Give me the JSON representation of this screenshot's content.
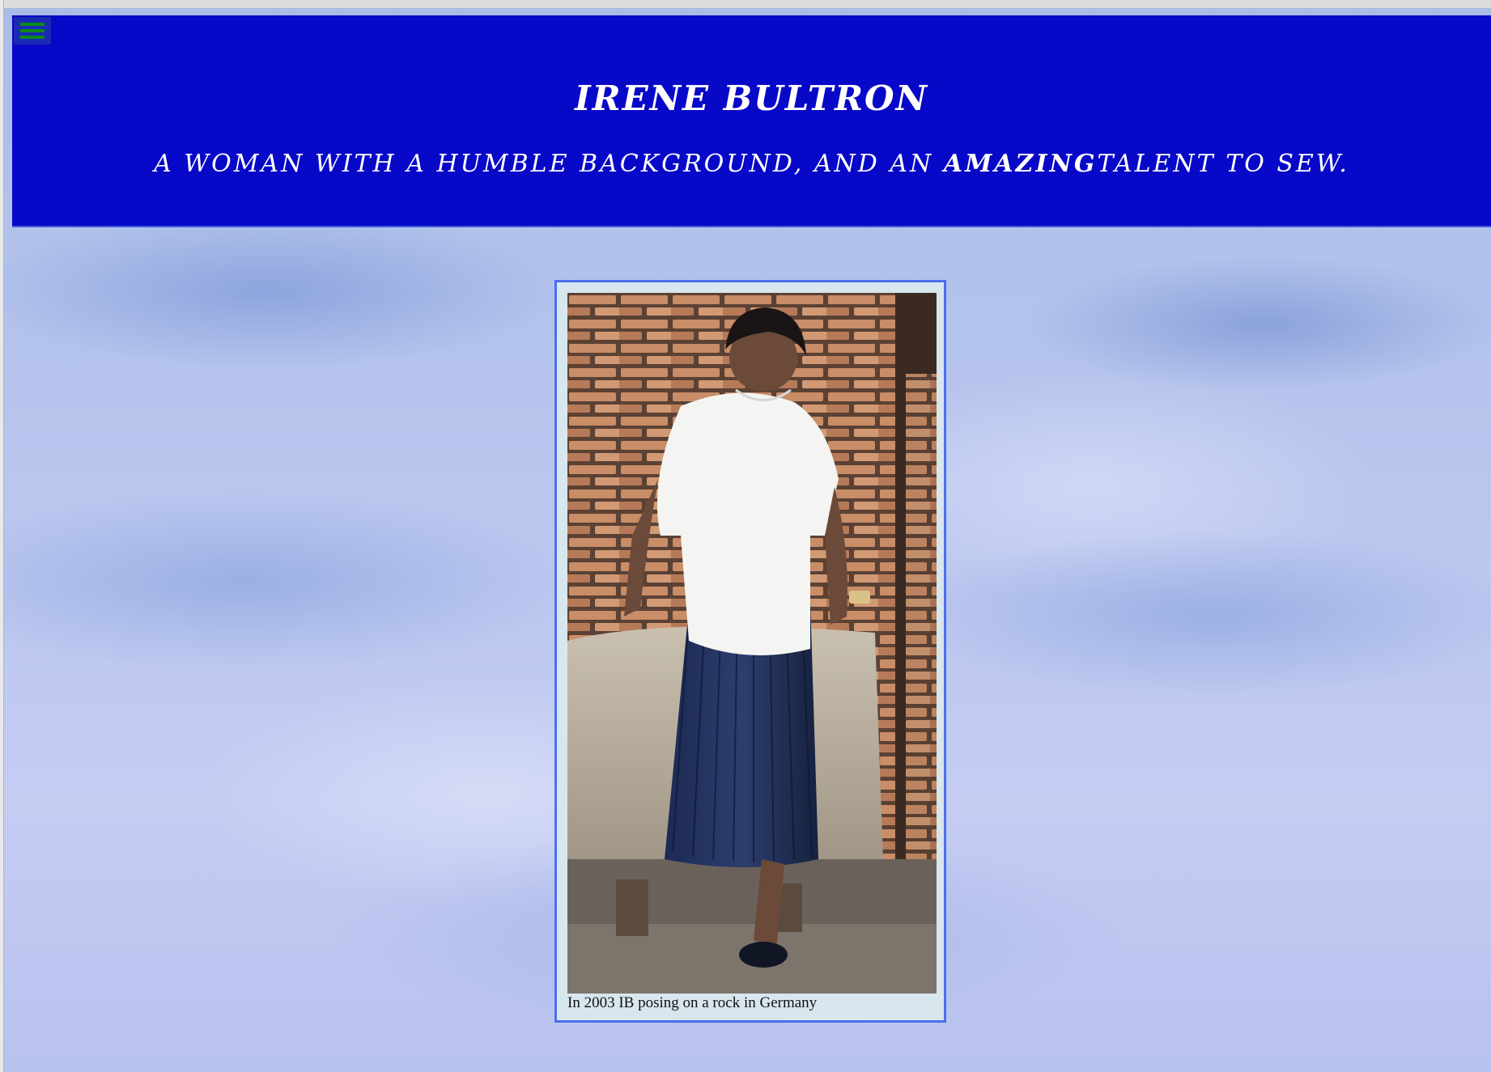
{
  "header": {
    "title": "IRENE BULTRON",
    "subtitle_before": "A WOMAN WITH A HUMBLE BACKGROUND, AND AN ",
    "subtitle_emphasis": "AMAZING",
    "subtitle_after": "TALENT TO SEW."
  },
  "menu": {
    "icon": "hamburger-menu-icon",
    "icon_color": "#0b8a17"
  },
  "figure": {
    "caption": "In 2003 IB posing on a rock in Germany",
    "photo_description_icon": "photo"
  },
  "colors": {
    "header_background": "#0808c8",
    "header_text": "#ffffff",
    "figure_border": "#4b6ff0",
    "figure_background": "#d8e6ee"
  }
}
